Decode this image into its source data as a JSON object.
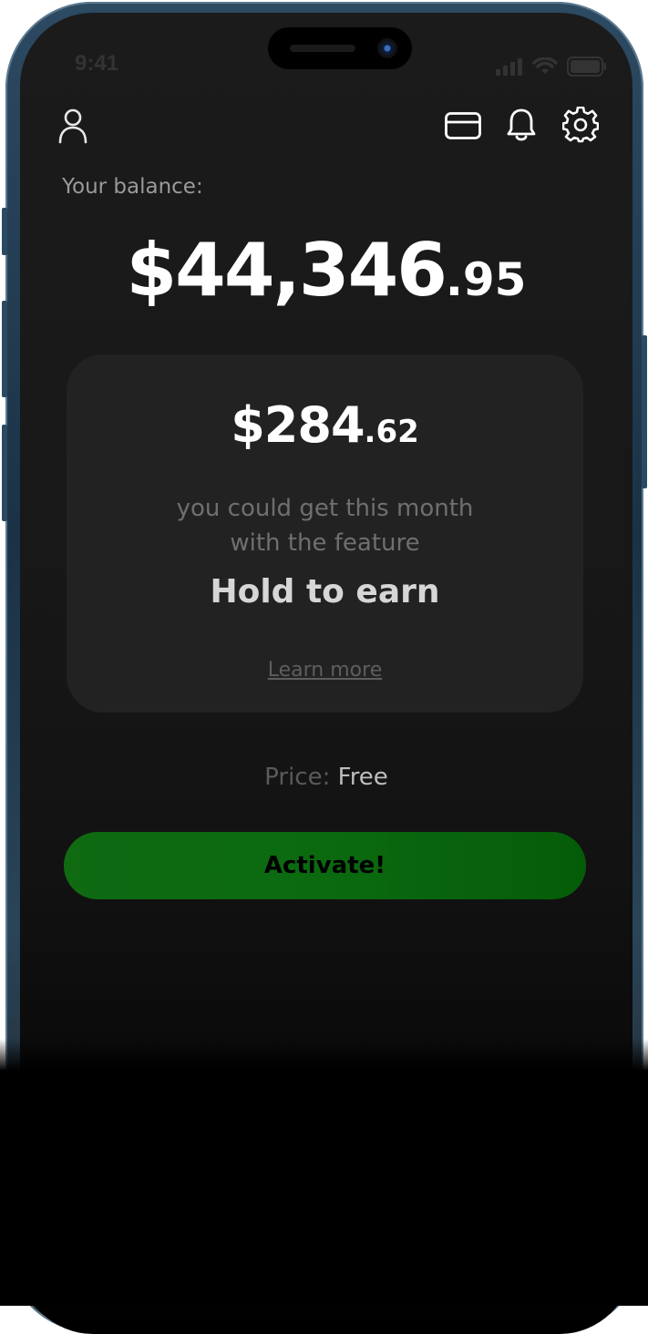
{
  "status_bar": {
    "time": "9:41"
  },
  "header": {
    "profile_icon": "user-icon",
    "card_icon": "credit-card-icon",
    "bell_icon": "bell-icon",
    "settings_icon": "gear-icon"
  },
  "balance": {
    "label": "Your balance:",
    "main": "$44,346",
    "cents": ".95"
  },
  "promo_card": {
    "amount_main": "$284",
    "amount_cents": ".62",
    "description_line1": "you could get this month",
    "description_line2": "with the feature",
    "feature_name": "Hold to earn",
    "learn_more": "Learn more"
  },
  "price": {
    "label": "Price:",
    "value": "Free"
  },
  "activate_button": {
    "label": "Activate!"
  },
  "colors": {
    "accent_green": "#0b6a10",
    "background": "#181818",
    "card_background": "#222222"
  }
}
